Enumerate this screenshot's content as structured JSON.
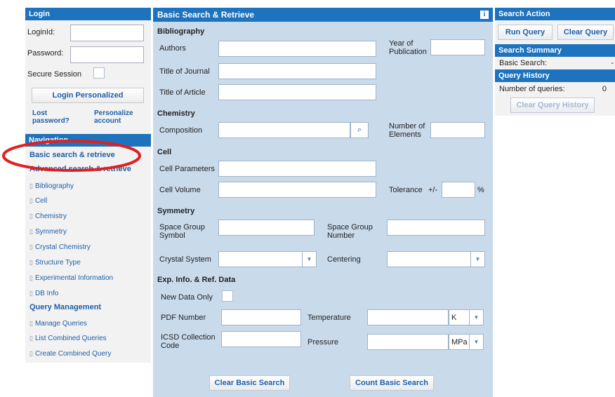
{
  "login": {
    "header": "Login",
    "login_id_label": "LoginId:",
    "password_label": "Password:",
    "secure_label": "Secure Session",
    "button": "Login Personalized",
    "lost_password": "Lost password?",
    "personalize": "Personalize account"
  },
  "navigation": {
    "header": "Navigation",
    "basic": "Basic search & retrieve",
    "advanced": "Advanced search & retrieve",
    "items": [
      "Bibliography",
      "Cell",
      "Chemistry",
      "Symmetry",
      "Crystal Chemistry",
      "Structure Type",
      "Experimental Information",
      "DB Info"
    ],
    "query_management": "Query Management",
    "query_items": [
      "Manage Queries",
      "List Combined Queries",
      "Create Combined Query"
    ]
  },
  "center": {
    "title": "Basic Search & Retrieve",
    "info_icon": "i",
    "bibliography": {
      "heading": "Bibliography",
      "authors": "Authors",
      "year": "Year of Publication",
      "journal": "Title of Journal",
      "article": "Title of Article"
    },
    "chemistry": {
      "heading": "Chemistry",
      "composition": "Composition",
      "num_elements": "Number of Elements"
    },
    "cell": {
      "heading": "Cell",
      "parameters": "Cell Parameters",
      "volume": "Cell Volume",
      "tolerance": "Tolerance",
      "plusminus": "+/-",
      "percent": "%"
    },
    "symmetry": {
      "heading": "Symmetry",
      "sg_symbol": "Space Group Symbol",
      "sg_number": "Space Group Number",
      "crystal_system": "Crystal System",
      "centering": "Centering"
    },
    "exp": {
      "heading": "Exp. Info. & Ref. Data",
      "new_data_only": "New Data Only",
      "pdf_number": "PDF Number",
      "temperature": "Temperature",
      "temp_unit": "K",
      "icsd_code": "ICSD Collection Code",
      "pressure": "Pressure",
      "pressure_unit": "MPa"
    },
    "clear_button": "Clear Basic Search",
    "count_button": "Count Basic Search"
  },
  "right": {
    "action_header": "Search Action",
    "run_query": "Run Query",
    "clear_query": "Clear Query",
    "summary_header": "Search Summary",
    "basic_search_label": "Basic Search:",
    "basic_search_value": "-",
    "history_header": "Query History",
    "num_queries_label": "Number of queries:",
    "num_queries_value": "0",
    "clear_history": "Clear Query History"
  },
  "colors": {
    "accent": "#1e73be",
    "panel": "#c9daeb",
    "highlight": "#e0201f"
  }
}
